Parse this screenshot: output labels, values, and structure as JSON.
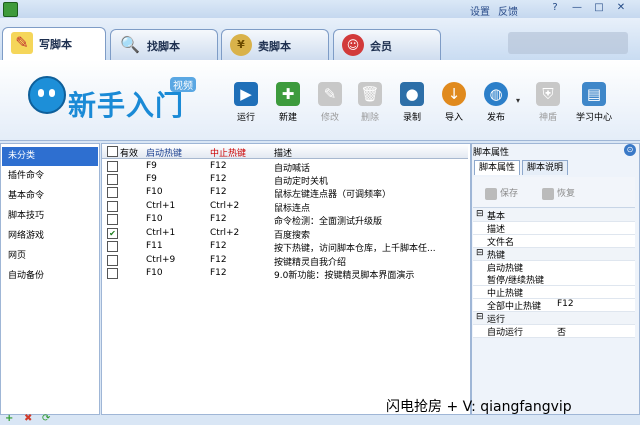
{
  "titlebar": {
    "settings": "设置",
    "feedback": "反馈",
    "btn_help": "?",
    "btn_min": "—",
    "btn_max": "□",
    "btn_close": "✕"
  },
  "tabs": [
    {
      "label": "写脚本",
      "icon": "pencil-icon",
      "active": true
    },
    {
      "label": "找脚本",
      "icon": "magnifier-icon",
      "active": false
    },
    {
      "label": "卖脚本",
      "icon": "money-bag-icon",
      "active": false
    },
    {
      "label": "会员",
      "icon": "member-icon",
      "active": false
    }
  ],
  "logo": {
    "text": "新手入门",
    "badge": "视频"
  },
  "toolbar": {
    "run": "运行",
    "new": "新建",
    "modify": "修改",
    "delete": "删除",
    "record": "录制",
    "import": "导入",
    "publish": "发布",
    "shield": "神盾",
    "learn": "学习中心"
  },
  "categories": [
    "未分类",
    "插件命令",
    "基本命令",
    "脚本技巧",
    "网络游戏",
    "网页",
    "自动备份"
  ],
  "left_footer": {
    "add": "+",
    "remove": "✖",
    "refresh": "⟳"
  },
  "list": {
    "headers": {
      "enabled": "有效",
      "start_hotkey": "启动热键",
      "stop_hotkey": "中止热键",
      "desc": "描述"
    },
    "rows": [
      {
        "checked": false,
        "start": "F9",
        "stop": "F12",
        "desc": "自动喊话"
      },
      {
        "checked": false,
        "start": "F9",
        "stop": "F12",
        "desc": "自动定时关机"
      },
      {
        "checked": false,
        "start": "F10",
        "stop": "F12",
        "desc": "鼠标左键连点器（可调频率）"
      },
      {
        "checked": false,
        "start": "Ctrl+1",
        "stop": "Ctrl+2",
        "desc": "鼠标连点"
      },
      {
        "checked": false,
        "start": "F10",
        "stop": "F12",
        "desc": "命令检测：全面测试升级版"
      },
      {
        "checked": true,
        "start": "Ctrl+1",
        "stop": "Ctrl+2",
        "desc": "百度搜索"
      },
      {
        "checked": false,
        "start": "F11",
        "stop": "F12",
        "desc": "按下热键，访问脚本仓库，上千脚本任..."
      },
      {
        "checked": false,
        "start": "Ctrl+9",
        "stop": "F12",
        "desc": "按键精灵自我介绍"
      },
      {
        "checked": false,
        "start": "F10",
        "stop": "F12",
        "desc": "9.0新功能：按键精灵脚本界面演示"
      }
    ]
  },
  "properties": {
    "title": "脚本属性",
    "tab_props": "脚本属性",
    "tab_desc": "脚本说明",
    "save": "保存",
    "restore": "恢复",
    "group_basic": "基本",
    "desc_key": "描述",
    "filename_key": "文件名",
    "group_hotkey": "热键",
    "start_key": "启动热键",
    "pause_key": "暂停/继续热键",
    "stop_key": "中止热键",
    "all_stop_key": "全部中止热键",
    "all_stop_val": "F12",
    "group_run": "运行",
    "autorun_key": "自动运行",
    "autorun_val": "否"
  },
  "watermark": "闪电抢房 + V: qiangfangvip",
  "colors": {
    "accent": "#2e6fd0",
    "stop_hotkey_header": "#cc0000",
    "start_hotkey_header": "#1a3f8f"
  }
}
